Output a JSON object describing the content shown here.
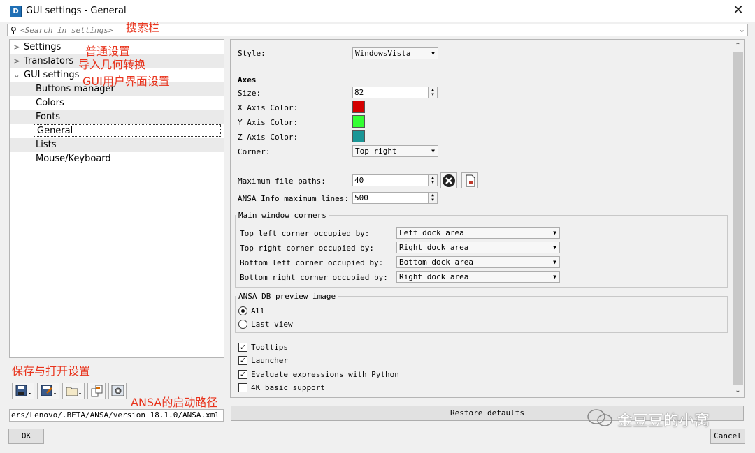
{
  "window": {
    "title": "GUI settings - General",
    "close_glyph": "✕",
    "app_icon_letter": "D"
  },
  "search": {
    "placeholder": "<Search in settings>",
    "icon": "search-icon"
  },
  "tree": [
    {
      "label": "Settings",
      "expanded": false
    },
    {
      "label": "Translators",
      "expanded": false
    },
    {
      "label": "GUI settings",
      "expanded": true
    }
  ],
  "tree_children": [
    "Buttons manager",
    "Colors",
    "Fonts",
    "General",
    "Lists",
    "Mouse/Keyboard"
  ],
  "selected_child": "General",
  "annotations": {
    "search": "搜索栏",
    "settings": "普通设置",
    "translators": "导入几何转换",
    "gui": "GUI用户界面设置",
    "save_open": "保存与打开设置",
    "startup_path": "ANSA的启动路径"
  },
  "toolbar_icons": [
    "save-icon",
    "save-as-icon",
    "open-folder-icon",
    "copy-icon",
    "settings-icon"
  ],
  "path_value": "ers/Lenovo/.BETA/ANSA/version_18.1.0/ANSA.xml",
  "general": {
    "style_label": "Style:",
    "style_value": "WindowsVista",
    "axes_heading": "Axes",
    "size_label": "Size:",
    "size_value": "82",
    "x_color_label": "X Axis Color:",
    "y_color_label": "Y Axis Color:",
    "z_color_label": "Z Axis Color:",
    "x_color": "#d40000",
    "y_color": "#33ff33",
    "z_color": "#1a9696",
    "corner_label": "Corner:",
    "corner_value": "Top right",
    "max_paths_label": "Maximum file paths:",
    "max_paths_value": "40",
    "info_lines_label": "ANSA Info maximum lines:",
    "info_lines_value": "500",
    "corners_group": "Main window corners",
    "corners": [
      {
        "label": "Top left corner occupied by:",
        "value": "Left dock area"
      },
      {
        "label": "Top right corner occupied by:",
        "value": "Right dock area"
      },
      {
        "label": "Bottom left corner occupied by:",
        "value": "Bottom dock area"
      },
      {
        "label": "Bottom right corner occupied by:",
        "value": "Right dock area"
      }
    ],
    "preview_group": "ANSA DB preview image",
    "preview_all": "All",
    "preview_last": "Last view",
    "checks": [
      {
        "label": "Tooltips",
        "checked": true
      },
      {
        "label": "Launcher",
        "checked": true
      },
      {
        "label": "Evaluate expressions with Python",
        "checked": true
      },
      {
        "label": "4K basic support",
        "checked": false
      }
    ],
    "restore_label": "Restore defaults"
  },
  "footer": {
    "ok_label": "OK",
    "cancel_label": "Cancel"
  },
  "watermark": "金豆豆的小窝"
}
